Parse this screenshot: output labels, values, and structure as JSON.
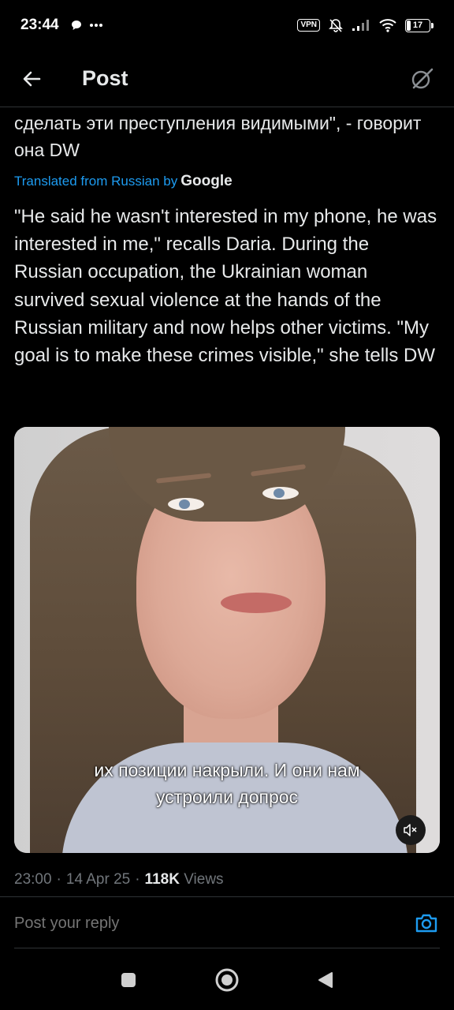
{
  "status_bar": {
    "time": "23:44",
    "vpn_label": "VPN",
    "battery_level": "17",
    "battery_fraction": 0.17
  },
  "header": {
    "title": "Post"
  },
  "post": {
    "original_text": "сделать эти преступления видимыми\", - говорит она DW",
    "translated_from_label": "Translated from Russian by",
    "translator_brand": "Google",
    "translated_text": "\"He said he wasn't interested in my phone, he was interested in me,\" recalls Daria. During the Russian occupation, the Ukrainian woman survived sexual violence at the hands of the Russian military and now helps other victims. \"My goal is to make these crimes visible,\" she tells DW",
    "video": {
      "subtitle_line_1": "их позиции накрыли. И они нам",
      "subtitle_line_2": "устроили допрос"
    },
    "meta": {
      "time": "23:00",
      "separator_1": "·",
      "date": "14 Apr 25",
      "separator_2": "·",
      "views_count": "118K",
      "views_label": "Views"
    }
  },
  "reply": {
    "placeholder": "Post your reply"
  },
  "colors": {
    "background": "#000000",
    "text": "#e7e9ea",
    "muted": "#71767b",
    "accent": "#1d9bf0",
    "divider": "#2f3336"
  },
  "icons": {
    "back": "arrow-left-icon",
    "grok": "grok-slash-icon",
    "mute": "speaker-muted-icon",
    "camera": "camera-icon",
    "nav_recents": "square-icon",
    "nav_home": "circle-icon",
    "nav_back": "triangle-back-icon"
  }
}
